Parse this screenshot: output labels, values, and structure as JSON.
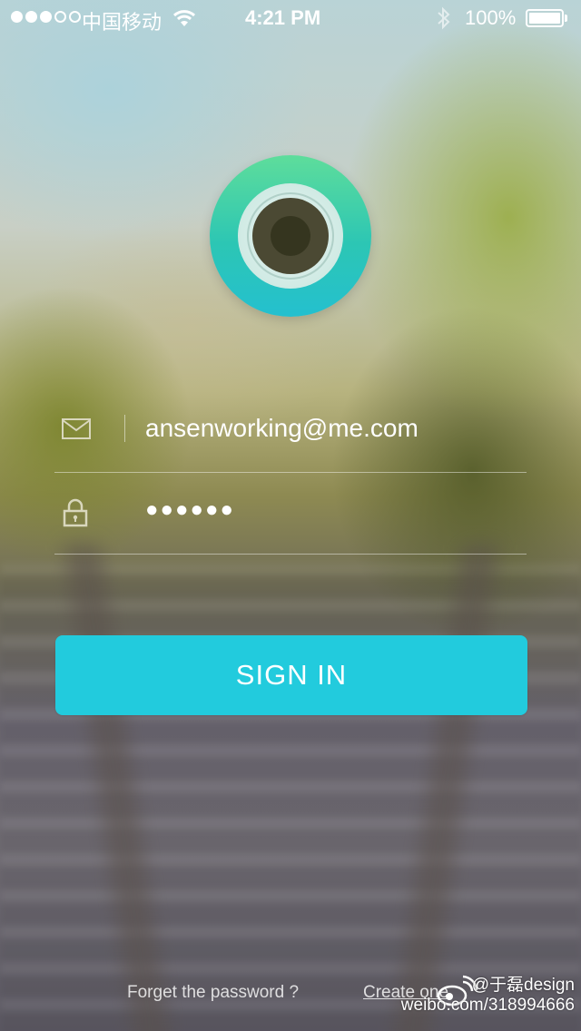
{
  "status_bar": {
    "carrier": "中国移动",
    "time": "4:21 PM",
    "battery_percent": "100%",
    "signal_bars_filled": 3,
    "signal_bars_total": 5
  },
  "login_form": {
    "email_value": "ansenworking@me.com",
    "password_masked": "●●●●●●",
    "email_icon": "envelope-icon",
    "password_icon": "lock-icon"
  },
  "sign_in_button": {
    "label": "SIGN IN",
    "color": "#22cbdd"
  },
  "footer": {
    "forgot_label": "Forget the password ?",
    "create_label": "Create one"
  },
  "watermark": {
    "handle": "@于磊design",
    "url": "weibo.com/318994666"
  },
  "colors": {
    "logo_top": "#5edd9b",
    "logo_bottom": "#24c0cf"
  }
}
